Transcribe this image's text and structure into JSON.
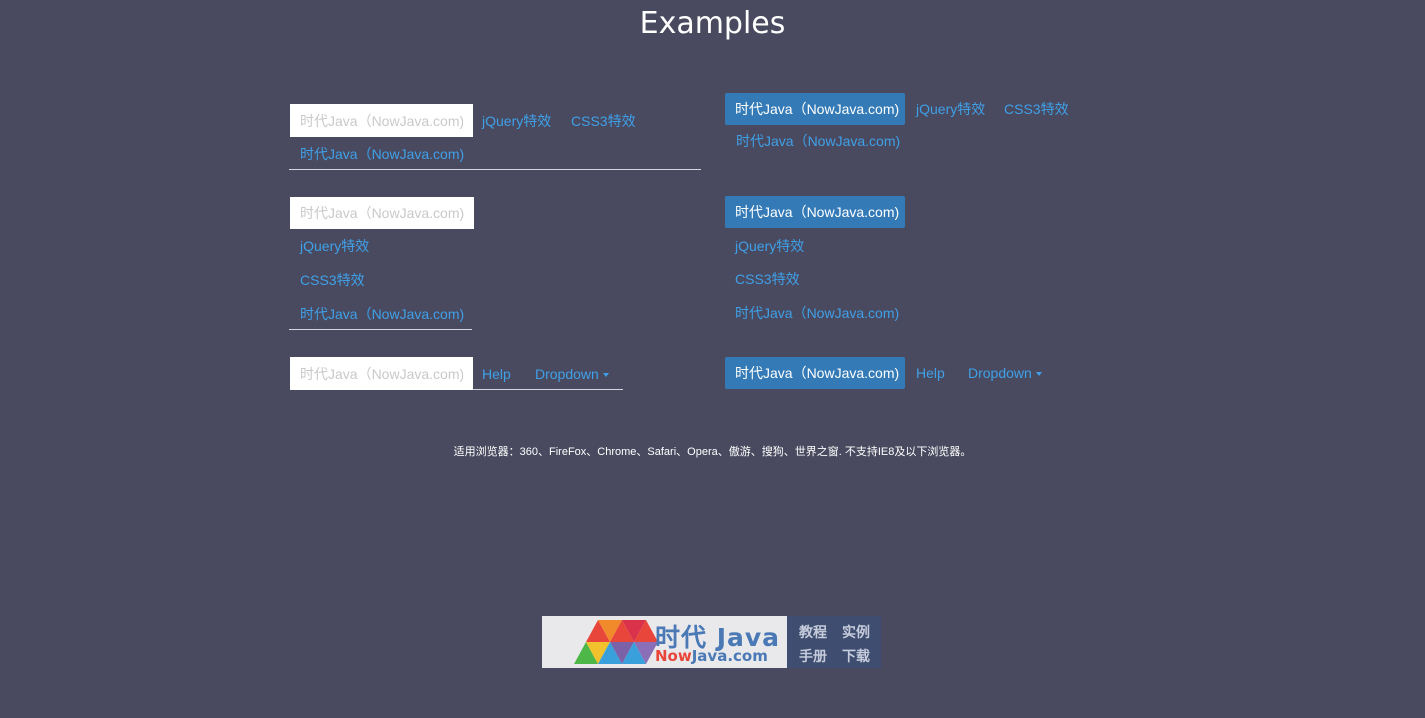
{
  "page": {
    "title": "Examples"
  },
  "example1": {
    "input_placeholder": "时代Java（NowJava.com)",
    "links": [
      "jQuery特效",
      "CSS3特效",
      "时代Java（NowJava.com)"
    ]
  },
  "example2": {
    "brand": "时代Java（NowJava.com)",
    "links": [
      "jQuery特效",
      "CSS3特效",
      "时代Java（NowJava.com)"
    ]
  },
  "example3": {
    "input_placeholder": "时代Java（NowJava.com)",
    "links": [
      "jQuery特效",
      "CSS3特效",
      "时代Java（NowJava.com)"
    ]
  },
  "example4": {
    "brand": "时代Java（NowJava.com)",
    "links": [
      "jQuery特效",
      "CSS3特效",
      "时代Java（NowJava.com)"
    ]
  },
  "example5": {
    "input_placeholder": "时代Java（NowJava.com)",
    "help": "Help",
    "dropdown": "Dropdown"
  },
  "example6": {
    "brand": "时代Java（NowJava.com)",
    "help": "Help",
    "dropdown": "Dropdown"
  },
  "footer": {
    "note": "适用浏览器：360、FireFox、Chrome、Safari、Opera、傲游、搜狗、世界之窗. 不支持IE8及以下浏览器。"
  },
  "logo": {
    "name_cn": "时代 Java",
    "name_en_accent": "Now",
    "name_en_rest": "Java.com",
    "tags": [
      "教程",
      "实例",
      "手册",
      "下载"
    ]
  },
  "colors": {
    "background": "#494a5f",
    "link": "#3fa0e8",
    "brand_button": "#337ab7"
  }
}
